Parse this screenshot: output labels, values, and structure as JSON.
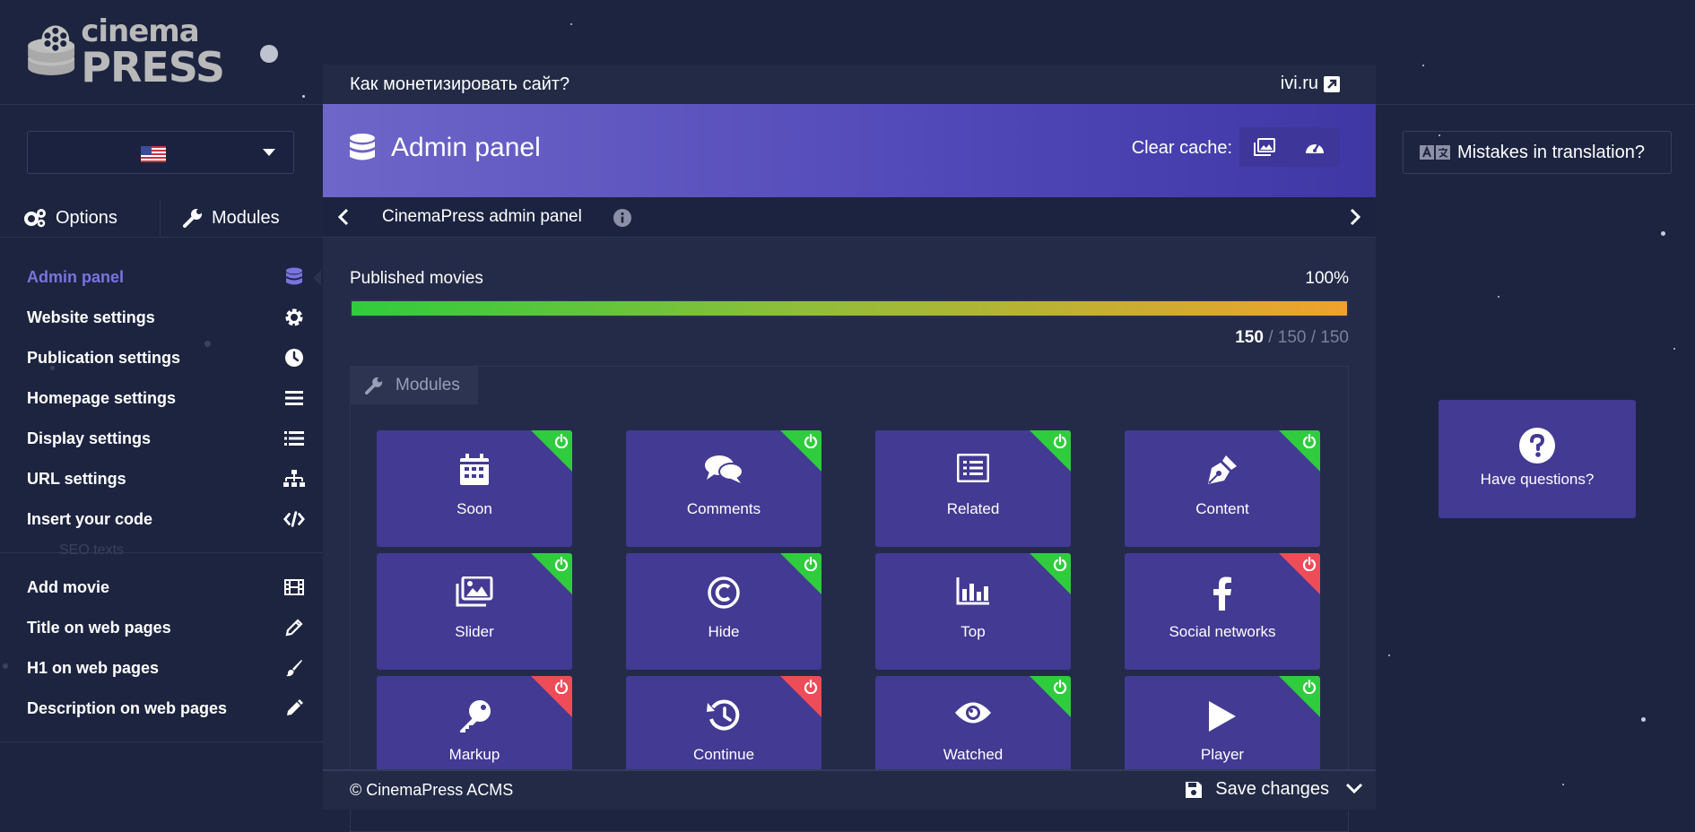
{
  "logo": {
    "line1": "cinema",
    "line2": "PRESS"
  },
  "language": {
    "selected": "en-US",
    "icon": "us-flag-icon"
  },
  "left_tabs": [
    {
      "label": "Options",
      "icon": "gears-icon"
    },
    {
      "label": "Modules",
      "icon": "wrench-icon"
    }
  ],
  "menu": {
    "items": [
      {
        "label": "Admin panel",
        "icon": "database-icon",
        "active": true
      },
      {
        "label": "Website settings",
        "icon": "gear-icon"
      },
      {
        "label": "Publication settings",
        "icon": "clock-icon"
      },
      {
        "label": "Homepage settings",
        "icon": "bars-icon"
      },
      {
        "label": "Display settings",
        "icon": "list-icon"
      },
      {
        "label": "URL settings",
        "icon": "sitemap-icon"
      },
      {
        "label": "Insert your code",
        "icon": "code-icon"
      }
    ],
    "section_label": "SEO texts",
    "seo_items": [
      {
        "label": "Add movie",
        "icon": "film-icon"
      },
      {
        "label": "Title on web pages",
        "icon": "pencil-icon"
      },
      {
        "label": "H1 on web pages",
        "icon": "paint-brush-icon"
      },
      {
        "label": "Description on web pages",
        "icon": "pen-icon"
      }
    ]
  },
  "topbar": {
    "monetize_text": "Как монетизировать сайт?",
    "link_text": "ivi.ru"
  },
  "header": {
    "title": "Admin panel",
    "clear_cache_label": "Clear cache:"
  },
  "breadcrumb": {
    "text": "CinemaPress admin panel"
  },
  "published": {
    "label": "Published movies",
    "percent_text": "100%",
    "progress": 1.0,
    "count_current": "150",
    "count_rest": " / 150 / 150"
  },
  "modules": {
    "tab_label": "Modules",
    "tiles": [
      {
        "label": "Soon",
        "icon": "calendar-icon",
        "enabled": true
      },
      {
        "label": "Comments",
        "icon": "comments-icon",
        "enabled": true
      },
      {
        "label": "Related",
        "icon": "list-alt-icon",
        "enabled": true
      },
      {
        "label": "Content",
        "icon": "pen-nib-icon",
        "enabled": true
      },
      {
        "label": "Slider",
        "icon": "images-icon",
        "enabled": true
      },
      {
        "label": "Hide",
        "icon": "copyright-icon",
        "enabled": true
      },
      {
        "label": "Top",
        "icon": "chart-bar-icon",
        "enabled": true
      },
      {
        "label": "Social networks",
        "icon": "facebook-icon",
        "enabled": false
      },
      {
        "label": "Markup",
        "icon": "key-icon",
        "enabled": false
      },
      {
        "label": "Continue",
        "icon": "history-icon",
        "enabled": false
      },
      {
        "label": "Watched",
        "icon": "eye-icon",
        "enabled": true
      },
      {
        "label": "Player",
        "icon": "play-icon",
        "enabled": true
      }
    ],
    "colors": {
      "on": "#2fcc3d",
      "off": "#ee4c58",
      "tile": "#433a93"
    }
  },
  "footer": {
    "copyright": "© CinemaPress ACMS",
    "save_label": "Save changes"
  },
  "right": {
    "mistakes_label": "Mistakes in translation?",
    "questions_label": "Have questions?"
  },
  "colors": {
    "background": "#1d2440",
    "accent": "#7a73e0",
    "header_gradient": [
      "#6e66c8",
      "#3e37a4"
    ]
  }
}
